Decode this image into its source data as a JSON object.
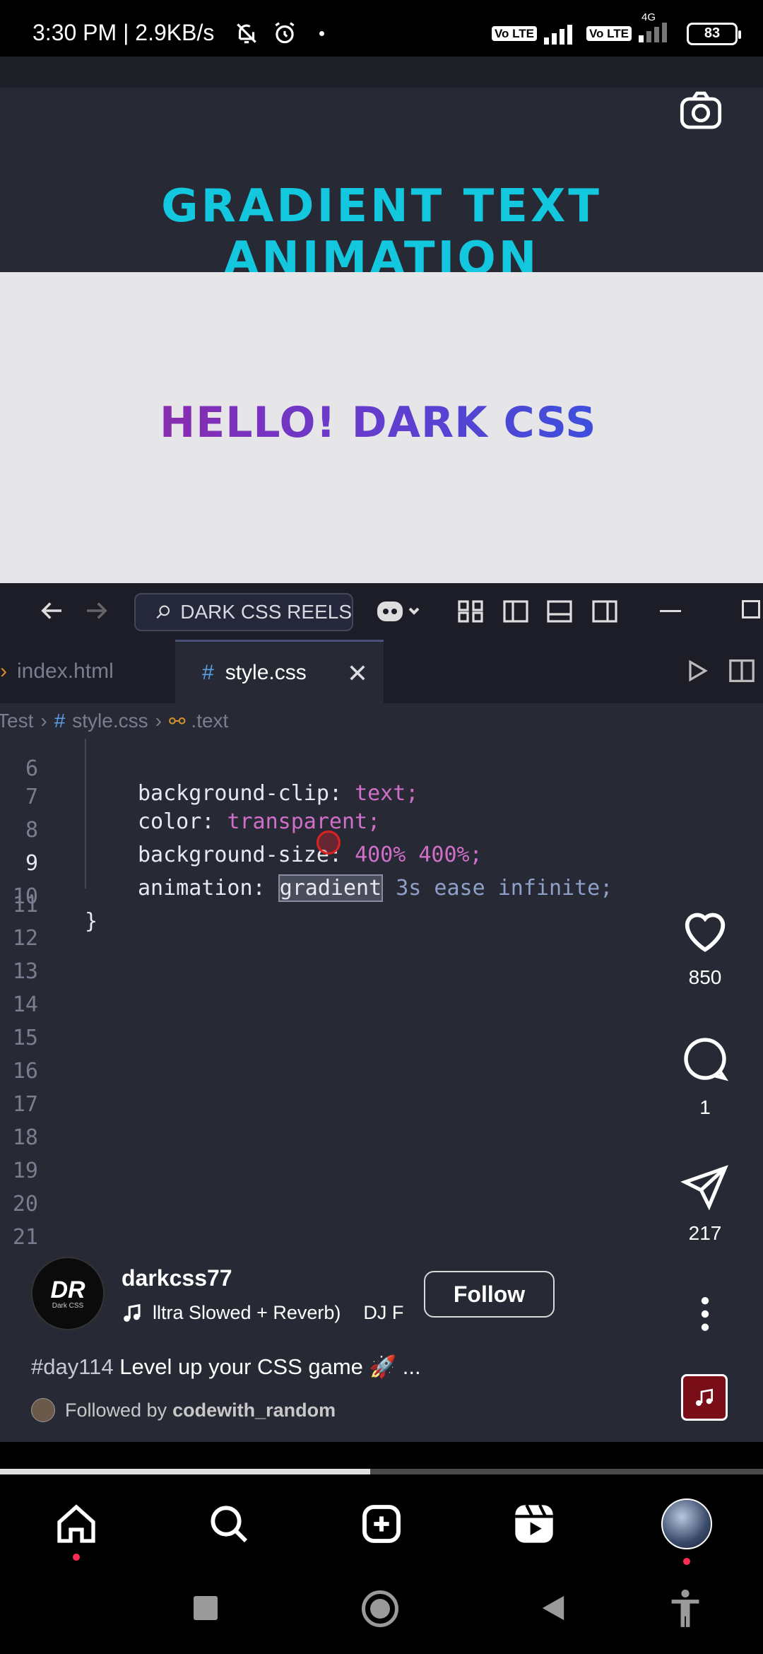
{
  "status_bar": {
    "time": "3:30 PM | 2.9KB/s",
    "net1": "Vo LTE",
    "net2": "Vo LTE",
    "net_type": "4G",
    "battery": "83"
  },
  "video": {
    "heading": "GRADIENT TEXT ANIMATION",
    "preview_text": "HELLO! DARK CSS",
    "editor": {
      "search": "DARK CSS REELS",
      "tab_inactive": "index.html",
      "tab_active": "style.css",
      "breadcrumb": {
        "root": "Test",
        "file": "style.css",
        "selector": ".text"
      },
      "lines": [
        {
          "n": "6",
          "prop": "background-clip",
          "value": "text;"
        },
        {
          "n": "7",
          "prop": "color",
          "value": "transparent;"
        },
        {
          "n": "8",
          "prop": "background-size",
          "value": "400% 400%;"
        },
        {
          "n": "9",
          "prop": "animation",
          "name": "gradient",
          "rest": "3s ease infinite;"
        },
        {
          "n": "10",
          "text": "}"
        },
        {
          "n": "11"
        },
        {
          "n": "12"
        },
        {
          "n": "13"
        },
        {
          "n": "14"
        },
        {
          "n": "15"
        },
        {
          "n": "16"
        },
        {
          "n": "17"
        },
        {
          "n": "18"
        },
        {
          "n": "19"
        },
        {
          "n": "20"
        },
        {
          "n": "21"
        }
      ]
    }
  },
  "actions": {
    "likes": "850",
    "comments": "1",
    "shares": "217"
  },
  "author": {
    "logo": "DR",
    "logo_sub": "Dark CSS",
    "username": "darkcss77",
    "music": "lltra Slowed + Reverb)",
    "music_artist": "DJ F",
    "follow_label": "Follow"
  },
  "caption": {
    "tag": "#day114",
    "text": "Level up your CSS game 🚀 ..."
  },
  "followed_by": {
    "prefix": "Followed by",
    "user": "codewith_random"
  },
  "progress": 0.485,
  "colors": {
    "accent_heading": "#12c7de",
    "editor_bg": "#272935",
    "notification_dot": "#ff2d55"
  }
}
